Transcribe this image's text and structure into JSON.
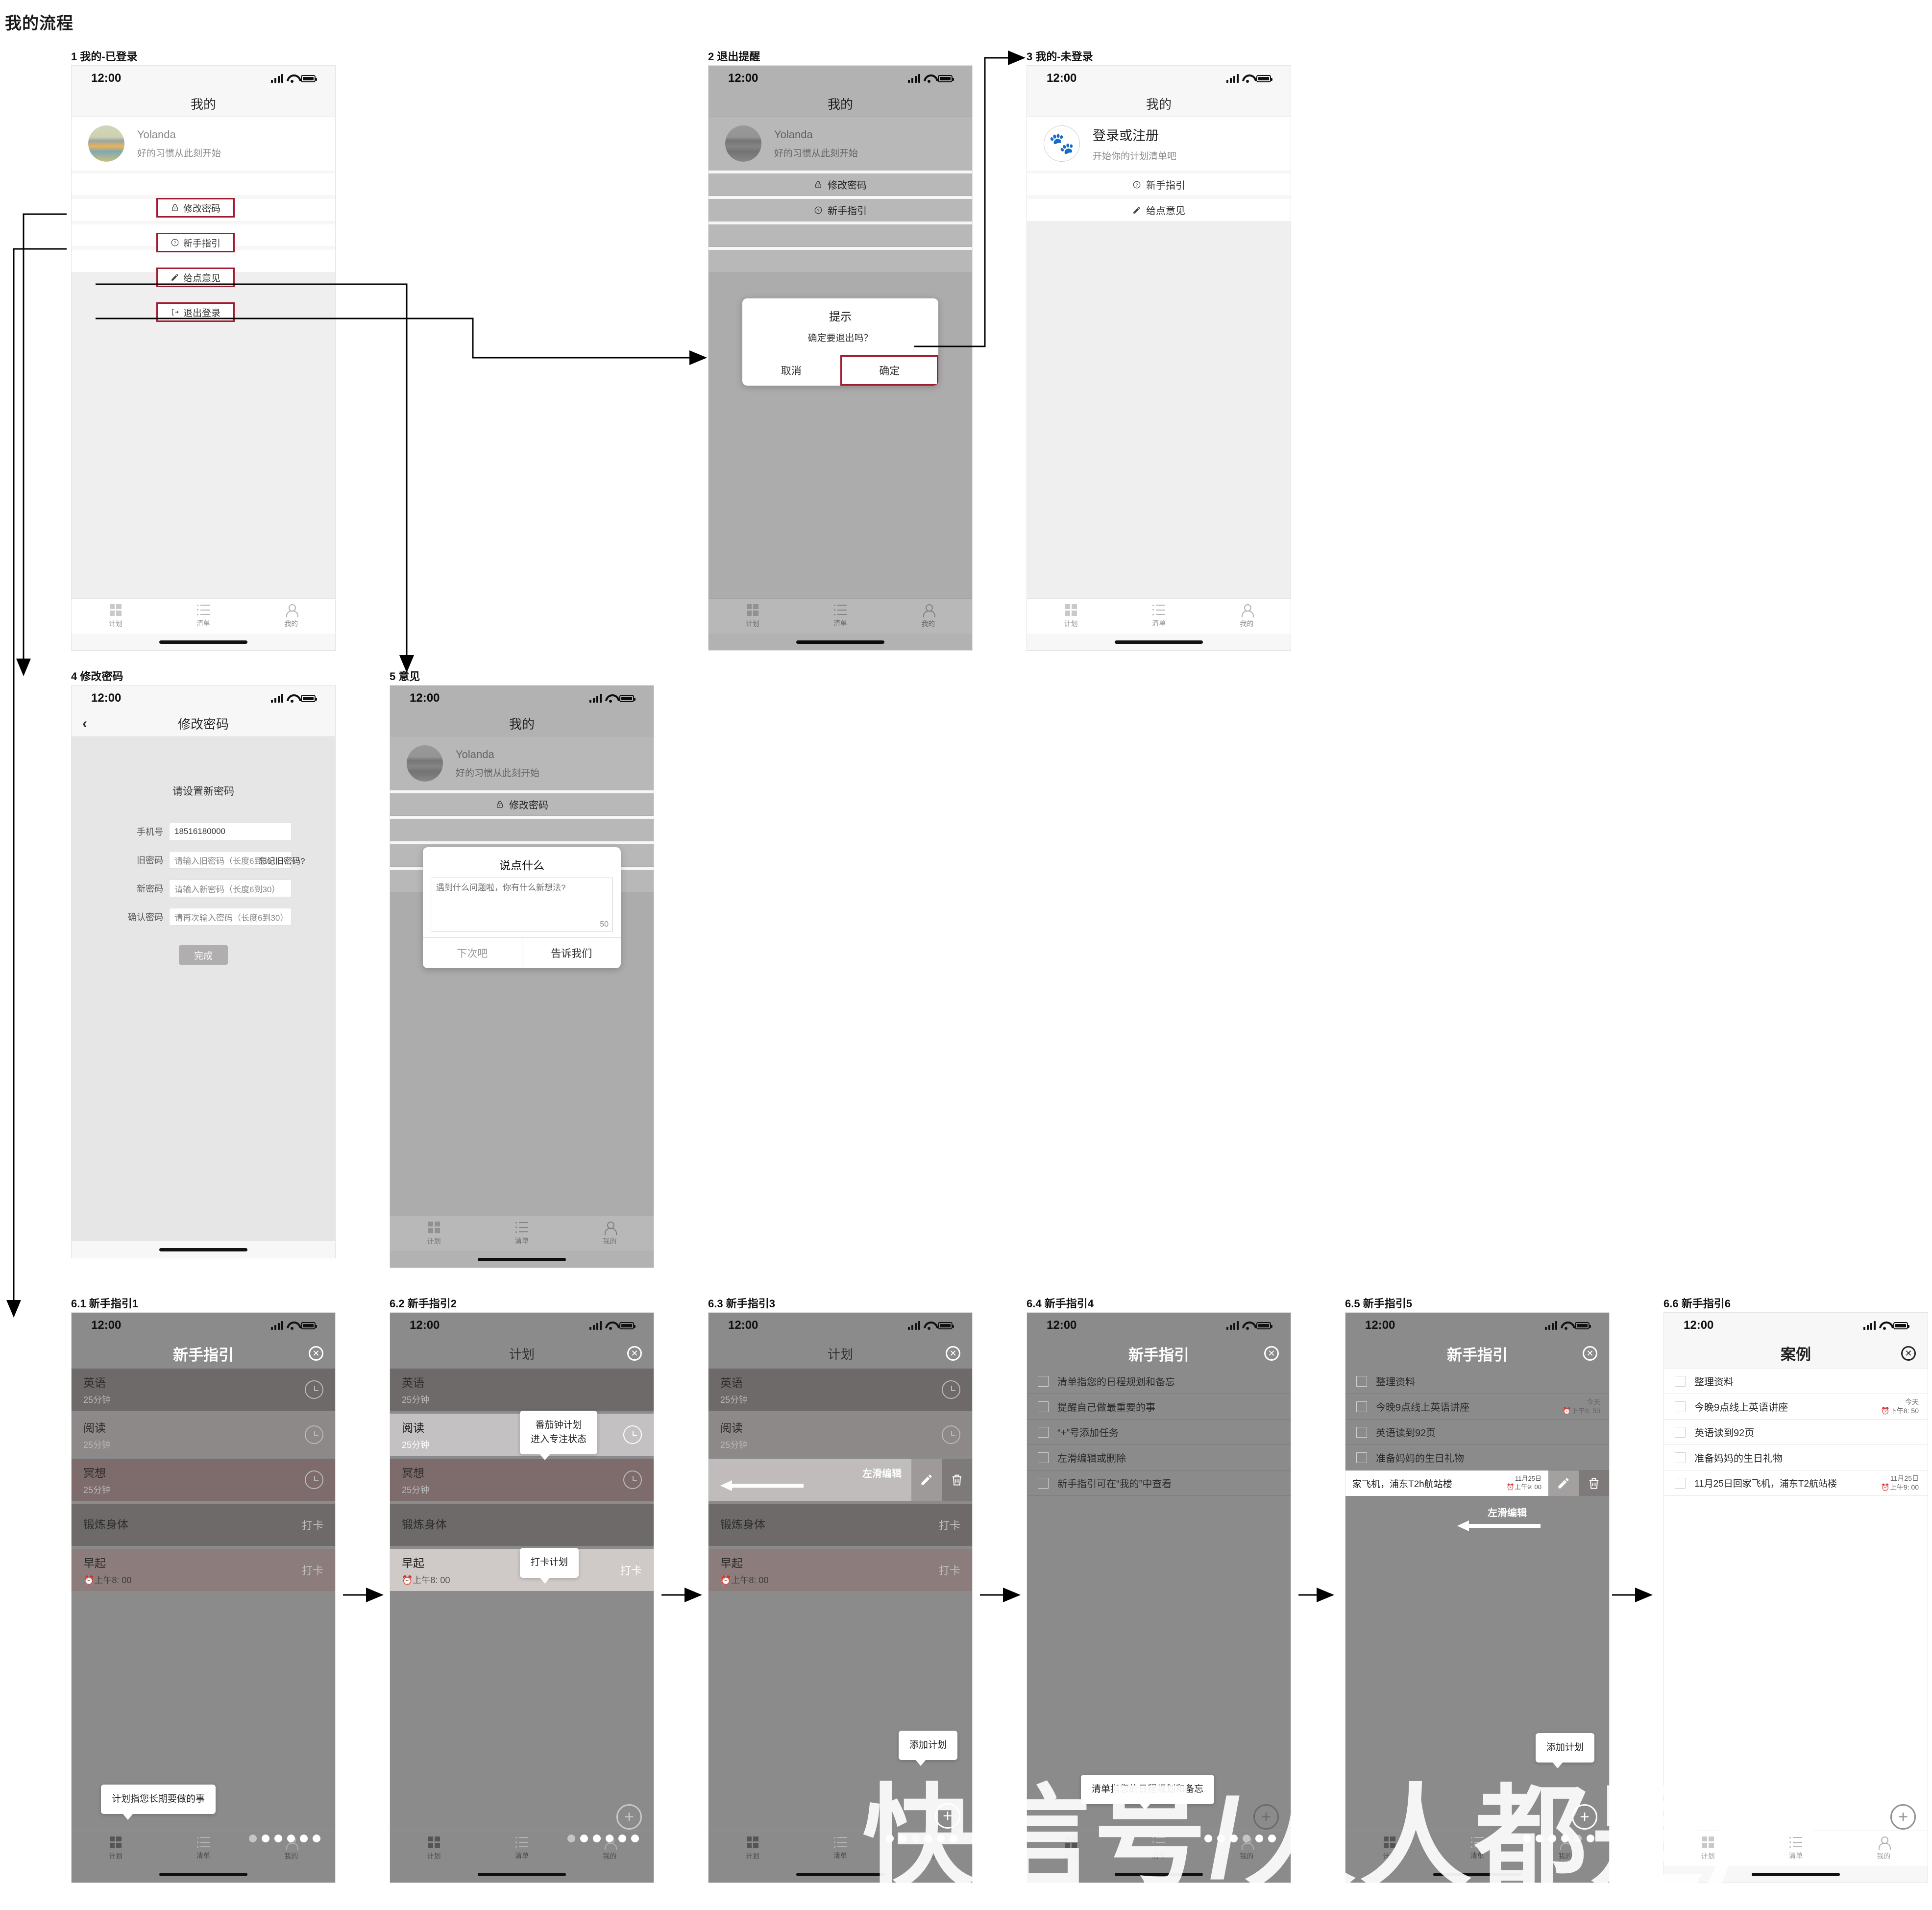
{
  "page": {
    "title": "我的流程",
    "watermark": "快信号/人人都是产"
  },
  "status": {
    "time": "12:00"
  },
  "tabbar": {
    "plan": "计划",
    "list": "清单",
    "mine": "我的"
  },
  "screens": {
    "s1": {
      "label": "1 我的-已登录",
      "nav_title": "我的",
      "user": {
        "name": "Yolanda",
        "slogan": "好的习惯从此刻开始"
      },
      "menu": [
        {
          "label": "修改密码",
          "icon": "lock-icon"
        },
        {
          "label": "新手指引",
          "icon": "question-icon"
        },
        {
          "label": "给点意见",
          "icon": "pencil-icon"
        },
        {
          "label": "退出登录",
          "icon": "logout-icon"
        }
      ]
    },
    "s2": {
      "label": "2 退出提醒",
      "nav_title": "我的",
      "user": {
        "name": "Yolanda",
        "slogan": "好的习惯从此刻开始"
      },
      "menu": [
        {
          "label": "修改密码",
          "icon": "lock-icon"
        },
        {
          "label": "新手指引",
          "icon": "question-icon"
        }
      ],
      "dialog": {
        "title": "提示",
        "message": "确定要退出吗？",
        "cancel": "取消",
        "confirm": "确定"
      }
    },
    "s3": {
      "label": "3 我的-未登录",
      "nav_title": "我的",
      "login": {
        "title": "登录或注册",
        "sub": "开始你的计划清单吧",
        "icon": "paw-icon"
      },
      "menu": [
        {
          "label": "新手指引",
          "icon": "question-icon"
        },
        {
          "label": "给点意见",
          "icon": "pencil-icon"
        }
      ]
    },
    "s4": {
      "label": "4 修改密码",
      "nav_title": "修改密码",
      "heading": "请设置新密码",
      "fields": [
        {
          "label": "手机号",
          "value": "18516180000",
          "placeholder": "",
          "filled": true
        },
        {
          "label": "旧密码",
          "value": "",
          "placeholder": "请输入旧密码（长度6到30）",
          "filled": false
        },
        {
          "label": "新密码",
          "value": "",
          "placeholder": "请输入新密码（长度6到30）",
          "filled": false
        },
        {
          "label": "确认密码",
          "value": "",
          "placeholder": "请再次输入密码（长度6到30）",
          "filled": false
        }
      ],
      "forgot": "忘记旧密码?",
      "submit": "完成"
    },
    "s5": {
      "label": "5 意见",
      "nav_title": "我的",
      "user": {
        "name": "Yolanda",
        "slogan": "好的习惯从此刻开始"
      },
      "menu": [
        {
          "label": "修改密码",
          "icon": "lock-icon"
        }
      ],
      "dialog": {
        "title": "说点什么",
        "placeholder": "遇到什么问题啦，你有什么新想法?",
        "counter": "50",
        "cancel": "下次吧",
        "confirm": "告诉我们"
      }
    },
    "s61": {
      "label": "6.1 新手指引1",
      "nav_title": "新手指引",
      "rows": [
        {
          "title": "英语",
          "sub": "25分钟",
          "right": "clock",
          "tone": "dark"
        },
        {
          "title": "阅读",
          "sub": "25分钟",
          "right": "clock",
          "tone": "mid"
        },
        {
          "title": "冥想",
          "sub": "25分钟",
          "right": "clock",
          "tone": "mauve"
        },
        {
          "title": "锻炼身体",
          "sub": "",
          "right": "打卡",
          "tone": "dark"
        },
        {
          "title": "早起",
          "sub": "上午8: 00",
          "right": "打卡",
          "tone": "mauve-lt"
        }
      ],
      "tooltip": "计划指您长期要做的事"
    },
    "s62": {
      "label": "6.2 新手指引2",
      "nav_title": "计划",
      "rows": [
        {
          "title": "英语",
          "sub": "25分钟",
          "right": "clock",
          "tone": "dark"
        },
        {
          "title": "阅读",
          "sub": "25分钟",
          "right": "clock",
          "tone": "light"
        },
        {
          "title": "冥想",
          "sub": "25分钟",
          "right": "clock",
          "tone": "mauve"
        },
        {
          "title": "锻炼身体",
          "sub": "",
          "right": "打卡",
          "tone": "dark"
        },
        {
          "title": "早起",
          "sub": "上午8: 00",
          "right": "打卡",
          "tone": "light2"
        }
      ],
      "tooltip_top": "番茄钟计划\n进入专注状态",
      "tooltip_top_l1": "番茄钟计划",
      "tooltip_top_l2": "进入专注状态",
      "tooltip_bottom": "打卡计划"
    },
    "s63": {
      "label": "6.3 新手指引3",
      "nav_title": "计划",
      "rows": [
        {
          "title": "英语",
          "sub": "25分钟",
          "right": "clock",
          "tone": "dark"
        },
        {
          "title": "阅读",
          "sub": "25分钟",
          "right": "clock",
          "tone": "mid"
        }
      ],
      "swipe_hint": "左滑编辑",
      "rows_after": [
        {
          "title": "锻炼身体",
          "sub": "",
          "right": "打卡",
          "tone": "dark"
        },
        {
          "title": "早起",
          "sub": "上午8: 00",
          "right": "打卡",
          "tone": "mauve-lt"
        }
      ],
      "tooltip": "添加计划"
    },
    "s64": {
      "label": "6.4 新手指引4",
      "nav_title": "新手指引",
      "items": [
        "清单指您的日程规划和备忘",
        "提醒自己做最重要的事",
        "“+”号添加任务",
        "左滑编辑或删除",
        "新手指引可在“我的”中查看"
      ],
      "tooltip": "清单指您的日程规划和备忘"
    },
    "s65": {
      "label": "6.5 新手指引5",
      "nav_title": "新手指引",
      "items": [
        {
          "text": "整理资料",
          "date": "",
          "time": ""
        },
        {
          "text": "今晚9点线上英语讲座",
          "date": "今天",
          "time": "下午8: 50"
        },
        {
          "text": "英语读到92页",
          "date": "",
          "time": ""
        },
        {
          "text": "准备妈妈的生日礼物",
          "date": "",
          "time": ""
        }
      ],
      "swipe_item": {
        "text": "家飞机，浦东T2h航站楼",
        "date": "11月25日",
        "time": "上午9: 00"
      },
      "swipe_hint": "左滑编辑",
      "tooltip": "添加计划"
    },
    "s66": {
      "label": "6.6 新手指引6",
      "nav_title": "案例",
      "items": [
        {
          "text": "整理资料",
          "date": "",
          "time": ""
        },
        {
          "text": "今晚9点线上英语讲座",
          "date": "今天",
          "time": "下午8: 50"
        },
        {
          "text": "英语读到92页",
          "date": "",
          "time": ""
        },
        {
          "text": "准备妈妈的生日礼物",
          "date": "",
          "time": ""
        },
        {
          "text": "11月25日回家飞机，浦东T2航站楼",
          "date": "11月25日",
          "time": "上午9: 00"
        }
      ]
    }
  },
  "colors": {
    "highlight": "#a11a2e",
    "accent_gray": "#8d8d8d"
  }
}
